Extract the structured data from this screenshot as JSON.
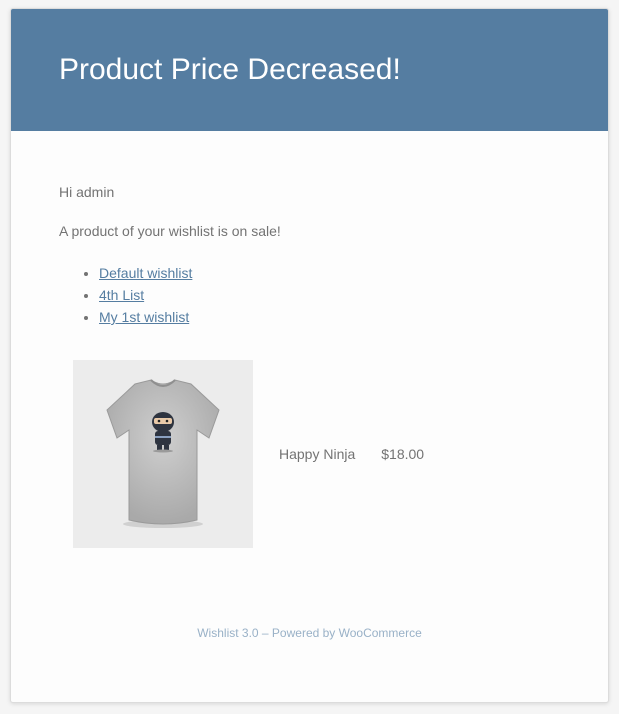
{
  "header": {
    "title": "Product Price Decreased!",
    "background_color": "#557da1"
  },
  "body": {
    "greeting": "Hi admin",
    "message": "A product of your wishlist is on sale!",
    "wishlists": [
      {
        "label": "Default wishlist"
      },
      {
        "label": "4th List"
      },
      {
        "label": "My 1st wishlist"
      }
    ],
    "link_color": "#557da1"
  },
  "product": {
    "image_icon": "tshirt-ninja-image",
    "name": "Happy Ninja",
    "price": "$18.00"
  },
  "footer": {
    "text": "Wishlist 3.0 – Powered by WooCommerce",
    "color": "#99b1c7"
  }
}
